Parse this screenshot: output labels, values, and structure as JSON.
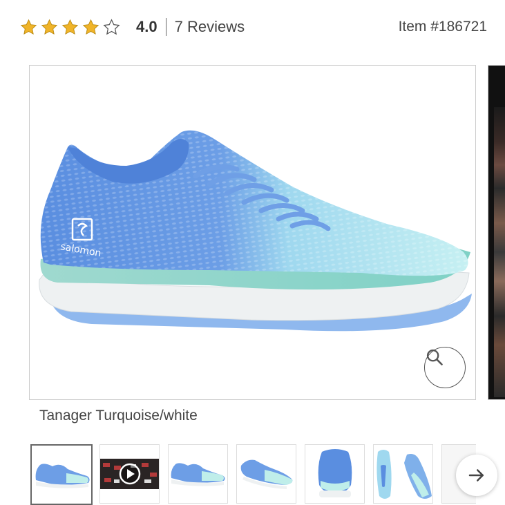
{
  "rating": {
    "value": 4,
    "max": 5,
    "value_label": "4.0",
    "reviews_label": "7 Reviews",
    "star_color": "#f0b429"
  },
  "item": {
    "label": "Item #186721"
  },
  "product": {
    "brand_logo_text": "salomon",
    "color_name": "Tanager Turquoise/white",
    "zoom_icon": "search-icon"
  },
  "gallery": {
    "selected_index": 0,
    "thumbnails": [
      {
        "kind": "shoe-side"
      },
      {
        "kind": "video"
      },
      {
        "kind": "shoe-side"
      },
      {
        "kind": "shoe-angle"
      },
      {
        "kind": "shoe-back"
      },
      {
        "kind": "shoe-top-sole"
      },
      {
        "kind": "partial"
      }
    ],
    "next_icon": "arrow-right-icon"
  },
  "colors": {
    "upper_blue": "#5b8fe0",
    "mint": "#bfeeea",
    "sole_teal": "#8fd8cf",
    "midsole_white": "#eef1f2"
  }
}
